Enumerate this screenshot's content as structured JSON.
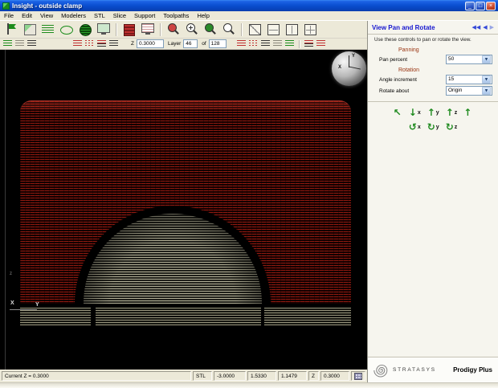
{
  "window": {
    "title": "Insight - outside clamp"
  },
  "titlebar": {
    "minimize": "_",
    "maximize": "□",
    "close": "×"
  },
  "menu": {
    "items": [
      "File",
      "Edit",
      "View",
      "Modelers",
      "STL",
      "Slice",
      "Support",
      "Toolpaths",
      "Help"
    ]
  },
  "toolbar": {
    "z_label": "Z",
    "z_value": "0.3000",
    "layer_label": "Layer",
    "layer_value": "46",
    "of_label": "of",
    "layer_total": "128"
  },
  "viewport": {
    "axis_x_label": "X",
    "axis_y_label": "Y",
    "z_marker": "z",
    "ball": {
      "x_label": "X",
      "y_label": "Y"
    }
  },
  "panel": {
    "title": "View Pan and Rotate",
    "nav": {
      "back_all": "◀◀",
      "back": "◀",
      "forward": "▶"
    },
    "description": "Use these controls to pan or rotate the view.",
    "panning": {
      "label": "Panning",
      "pan_percent_label": "Pan percent",
      "pan_percent_value": "50"
    },
    "rotation": {
      "label": "Rotation",
      "angle_label": "Angle increment",
      "angle_value": "15",
      "about_label": "Rotate about",
      "about_value": "Origin"
    },
    "pan_buttons": [
      {
        "glyph": "↖",
        "letter": ""
      },
      {
        "glyph": "↓",
        "letter": "x"
      },
      {
        "glyph": "↑",
        "letter": "y"
      },
      {
        "glyph": "↑",
        "letter": "z"
      },
      {
        "glyph": "↑",
        "letter": ""
      }
    ],
    "rotate_buttons": [
      {
        "glyph": "↺",
        "letter": "x"
      },
      {
        "glyph": "↻",
        "letter": "y"
      },
      {
        "glyph": "↻",
        "letter": "z"
      }
    ]
  },
  "branding": {
    "company": "STRATASYS",
    "product": "Prodigy Plus"
  },
  "statusbar": {
    "current_z": "Current Z = 0.3000",
    "format": "STL",
    "x": "-3.0000",
    "y": "1.5330",
    "z": "1.1479",
    "z_label": "Z",
    "z_value": "0.3000"
  },
  "icons": {
    "combo_arrow": "▼"
  },
  "colors": {
    "accent_blue": "#1515cf",
    "section_red": "#993310",
    "part_red": "#8e1a10",
    "arrow_green": "#1e8a1e"
  }
}
